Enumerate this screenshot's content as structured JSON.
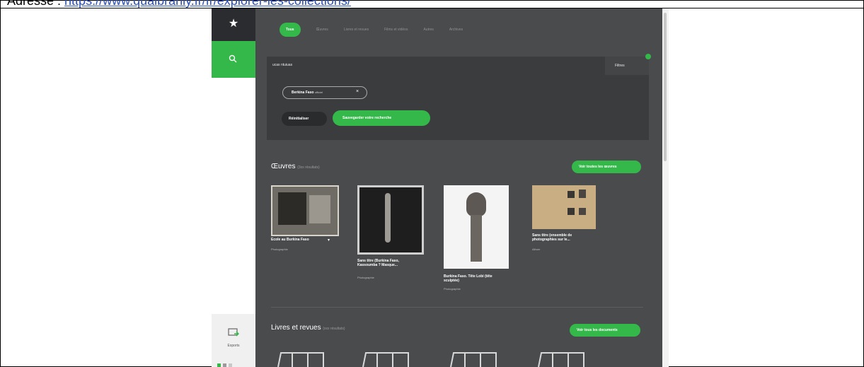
{
  "caption": {
    "prefix": "Adresse : ",
    "url": "https://www.quaibranly.fr/fr/explorer-les-collections/"
  },
  "sidebar": {
    "export_label": "Exports"
  },
  "tabs": [
    {
      "label": "Tous",
      "active": true
    },
    {
      "label": "Œuvres"
    },
    {
      "label": "Livres et revues"
    },
    {
      "label": "Films et vidéos"
    },
    {
      "label": "Autres"
    },
    {
      "label": "Archives"
    }
  ],
  "search": {
    "query": "ucas ntuiuas",
    "filter_label": "Filtres"
  },
  "filters": {
    "chip": "Berkina Faso",
    "chip_sub": "officiel",
    "reset_label": "Réinitialiser",
    "save_label": "Sauvegarder votre recherche"
  },
  "oeuvres": {
    "title": "Œuvres",
    "count": "(3xx résultats)",
    "button": "Voir toutes les œuvres",
    "items": [
      {
        "title": "Ecole au Burkina Faso",
        "type": "Photographie"
      },
      {
        "title": "Sans titre (Burkina Faso, Kassoumba ? Masque...",
        "type": "Photographie"
      },
      {
        "title": "Burkina Faso. Tête Lobi (tête sculptée)",
        "type": "Photographie"
      },
      {
        "title": "Sans titre (ensemble de photographies sur le...",
        "type": "Album"
      }
    ]
  },
  "livres": {
    "title": "Livres et revues",
    "count": "(xxx résultats)",
    "button": "Voir tous les documents"
  },
  "colors": {
    "accent": "#34b84a",
    "panel": "#4a4b4d",
    "dark": "#2b2c2f"
  }
}
